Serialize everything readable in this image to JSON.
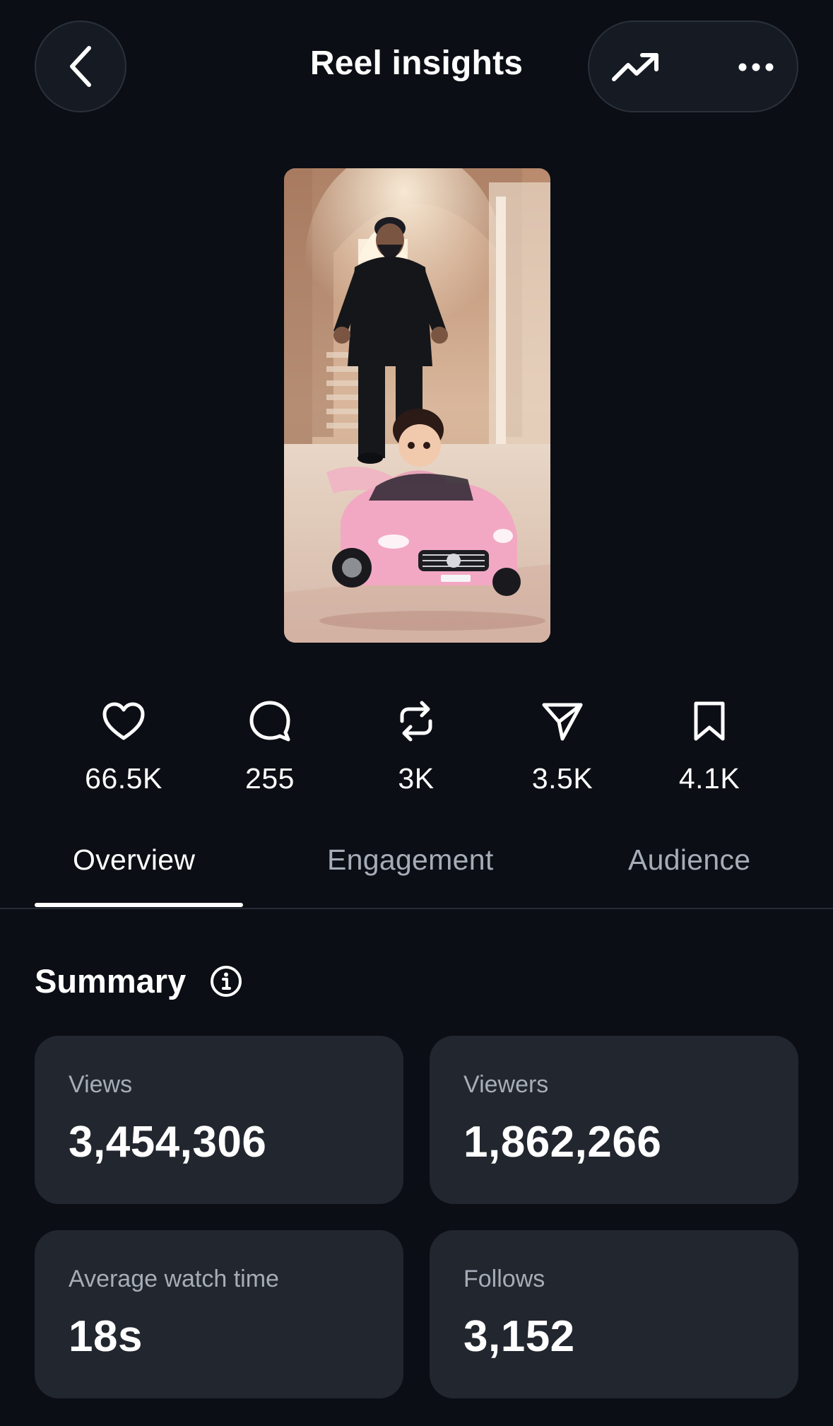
{
  "header": {
    "title": "Reel insights",
    "back_icon": "chevron-left-icon",
    "trend_icon": "trending-up-icon",
    "more_icon": "more-horizontal-icon"
  },
  "thumbnail": {
    "description_icon": "reel-thumbnail"
  },
  "stats": [
    {
      "icon": "heart-icon",
      "value": "66.5K"
    },
    {
      "icon": "comment-icon",
      "value": "255"
    },
    {
      "icon": "repost-icon",
      "value": "3K"
    },
    {
      "icon": "share-icon",
      "value": "3.5K"
    },
    {
      "icon": "save-icon",
      "value": "4.1K"
    }
  ],
  "tabs": [
    {
      "label": "Overview",
      "active": true
    },
    {
      "label": "Engagement",
      "active": false
    },
    {
      "label": "Audience",
      "active": false
    }
  ],
  "summary": {
    "title": "Summary",
    "cards": [
      {
        "label": "Views",
        "value": "3,454,306"
      },
      {
        "label": "Viewers",
        "value": "1,862,266"
      },
      {
        "label": "Average watch time",
        "value": "18s"
      },
      {
        "label": "Follows",
        "value": "3,152"
      }
    ]
  },
  "colors": {
    "background": "#0b0e14",
    "card": "#22262e",
    "muted_text": "#a6adb8",
    "text": "#ffffff"
  }
}
